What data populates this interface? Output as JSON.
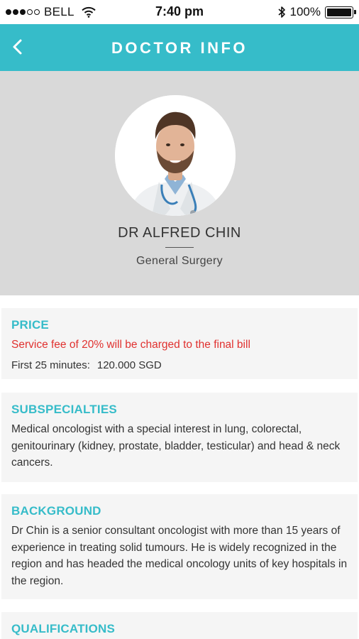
{
  "status_bar": {
    "carrier": "BELL",
    "time": "7:40 pm",
    "battery": "100%",
    "battery_level": 1.0
  },
  "nav": {
    "title": "DOCTOR INFO",
    "back_icon": "chevron-left-icon"
  },
  "doctor": {
    "name": "DR ALFRED CHIN",
    "specialty": "General Surgery"
  },
  "price": {
    "title": "PRICE",
    "fee_note": "Service fee of 20% will be charged to the final bill",
    "label": "First 25 minutes:",
    "amount": "120.000 SGD"
  },
  "subspecialties": {
    "title": "SUBSPECIALTIES",
    "text": "Medical oncologist with a special interest in lung, colorectal, genitourinary (kidney, prostate, bladder, testicular) and head & neck cancers."
  },
  "background": {
    "title": "BACKGROUND",
    "text": "Dr Chin is a senior consultant oncologist with more than 15 years of experience in treating solid tumours. He is widely recognized in the region and has headed the medical oncology units of key hospitals in the region."
  },
  "qualifications": {
    "title": "QUALIFICATIONS"
  },
  "colors": {
    "accent": "#36bcc9",
    "fee_red": "#e0312f",
    "profile_bg": "#d9d9d9",
    "card_bg": "#f5f5f5"
  }
}
